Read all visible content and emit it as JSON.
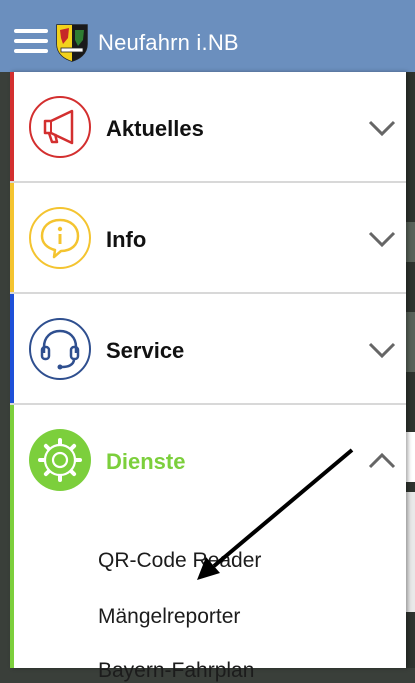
{
  "app_bar": {
    "title": "Neufahrn i.NB",
    "menu_icon": "hamburger-menu-icon",
    "crest_icon": "municipal-coat-of-arms-icon",
    "background_color": "#6b8fbe"
  },
  "menu": {
    "sections": [
      {
        "label": "Aktuelles",
        "icon": "megaphone-icon",
        "color": "#d32f2f",
        "state": "collapsed"
      },
      {
        "label": "Info",
        "icon": "info-bubble-icon",
        "color": "#f4c430",
        "state": "collapsed"
      },
      {
        "label": "Service",
        "icon": "headset-icon",
        "color": "#2f4f8f",
        "state": "collapsed"
      },
      {
        "label": "Dienste",
        "icon": "gear-icon",
        "color": "#7ccf3c",
        "state": "expanded"
      }
    ],
    "dienste_items": [
      "QR-Code Reader",
      "Mängelreporter",
      "Bayern-Fahrplan"
    ]
  },
  "annotation": {
    "icon": "pointer-arrow-icon",
    "target": "Mängelreporter",
    "color": "#000000"
  }
}
